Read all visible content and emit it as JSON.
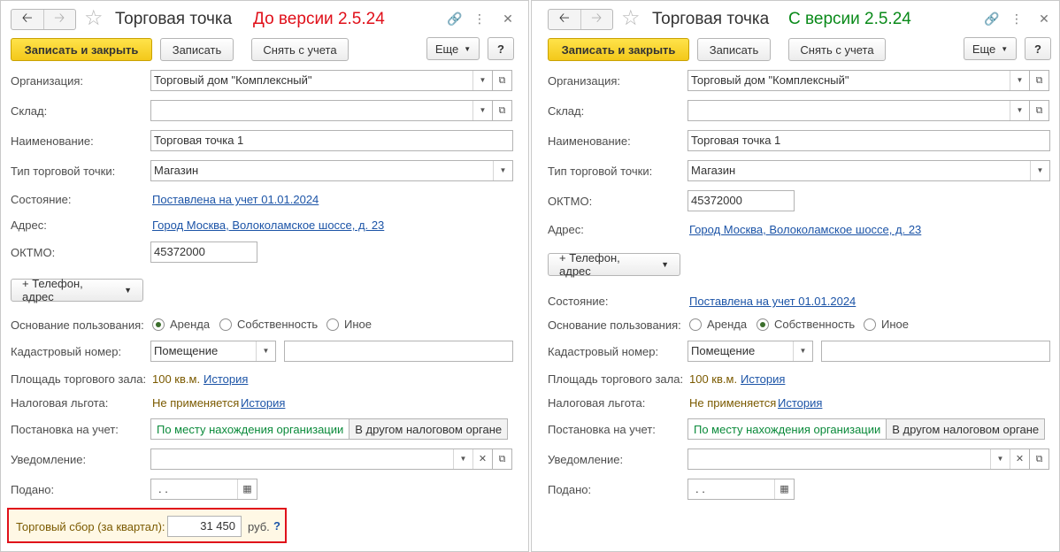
{
  "left": {
    "title": "Торговая точка",
    "version": "До версии 2.5.24",
    "version_color": "#e0101a",
    "buttons": {
      "save_close": "Записать и закрыть",
      "save": "Записать",
      "deregister": "Снять с учета",
      "more": "Еще",
      "help": "?"
    },
    "labels": {
      "org": "Организация:",
      "warehouse": "Склад:",
      "name": "Наименование:",
      "type": "Тип торговой точки:",
      "state": "Состояние:",
      "address": "Адрес:",
      "oktmo": "ОКТМО:",
      "basis": "Основание пользования:",
      "cadastral": "Кадастровый номер:",
      "area": "Площадь торгового зала:",
      "tax_benefit": "Налоговая льгота:",
      "registration": "Постановка на учет:",
      "notice": "Уведомление:",
      "submitted": "Подано:"
    },
    "values": {
      "org": "Торговый дом \"Комплексный\"",
      "warehouse": "",
      "name": "Торговая точка 1",
      "type": "Магазин",
      "state": "Поставлена на учет 01.01.2024",
      "address": "Город Москва, Волоколамское шоссе, д. 23",
      "oktmo": "45372000",
      "cadastral_type": "Помещение",
      "cadastral_number": "",
      "area": "100 кв.м.",
      "area_history": "История",
      "tax_benefit": "Не применяется",
      "tax_history": "История",
      "notice": "",
      "submitted": " .  ."
    },
    "phone_address_button": "+ Телефон, адрес",
    "basis_options": [
      "Аренда",
      "Собственность",
      "Иное"
    ],
    "basis_selected": "Аренда",
    "registration_options": [
      "По месту нахождения организации",
      "В другом налоговом органе"
    ],
    "fee": {
      "label": "Торговый сбор (за квартал):",
      "value": "31 450",
      "unit": "руб.",
      "help": "?"
    }
  },
  "right": {
    "title": "Торговая точка",
    "version": "С версии 2.5.24",
    "version_color": "#0a8a1a",
    "buttons": {
      "save_close": "Записать и закрыть",
      "save": "Записать",
      "deregister": "Снять с учета",
      "more": "Еще",
      "help": "?"
    },
    "labels": {
      "org": "Организация:",
      "warehouse": "Склад:",
      "name": "Наименование:",
      "type": "Тип торговой точки:",
      "oktmo": "ОКТМО:",
      "address": "Адрес:",
      "state": "Состояние:",
      "basis": "Основание пользования:",
      "cadastral": "Кадастровый номер:",
      "area": "Площадь торгового зала:",
      "tax_benefit": "Налоговая льгота:",
      "registration": "Постановка на учет:",
      "notice": "Уведомление:",
      "submitted": "Подано:"
    },
    "values": {
      "org": "Торговый дом \"Комплексный\"",
      "warehouse": "",
      "name": "Торговая точка 1",
      "type": "Магазин",
      "oktmo": "45372000",
      "address": "Город Москва, Волоколамское шоссе, д. 23",
      "state": "Поставлена на учет 01.01.2024",
      "cadastral_type": "Помещение",
      "cadastral_number": "",
      "area": "100 кв.м.",
      "area_history": "История",
      "tax_benefit": "Не применяется",
      "tax_history": "История",
      "notice": "",
      "submitted": " .  ."
    },
    "phone_address_button": "+ Телефон, адрес",
    "basis_options": [
      "Аренда",
      "Собственность",
      "Иное"
    ],
    "basis_selected": "Собственность",
    "registration_options": [
      "По месту нахождения организации",
      "В другом налоговом органе"
    ]
  }
}
